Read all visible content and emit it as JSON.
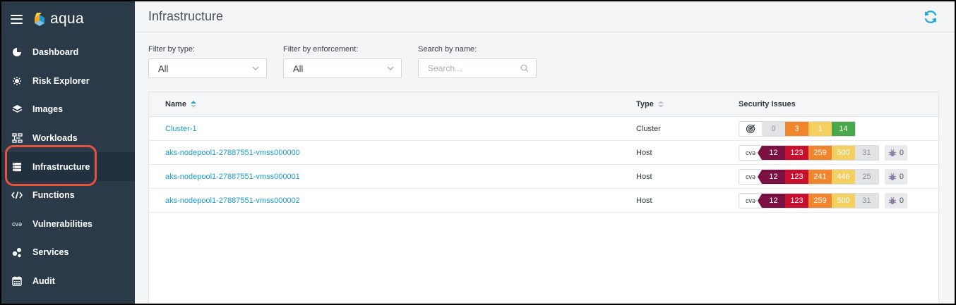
{
  "app": {
    "name": "aqua"
  },
  "sidebar": {
    "items": [
      {
        "label": "Dashboard",
        "icon": "dashboard-icon"
      },
      {
        "label": "Risk Explorer",
        "icon": "risk-explorer-icon"
      },
      {
        "label": "Images",
        "icon": "images-layers-icon"
      },
      {
        "label": "Workloads",
        "icon": "workloads-icon"
      },
      {
        "label": "Infrastructure",
        "icon": "infrastructure-server-icon",
        "active": true
      },
      {
        "label": "Functions",
        "icon": "functions-code-icon"
      },
      {
        "label": "Vulnerabilities",
        "icon": "cve-icon",
        "icon_text": "cvə"
      },
      {
        "label": "Services",
        "icon": "services-icon"
      },
      {
        "label": "Audit",
        "icon": "audit-calendar-icon"
      }
    ]
  },
  "page": {
    "title": "Infrastructure"
  },
  "filters": {
    "type": {
      "label": "Filter by type:",
      "value": "All"
    },
    "enforcement": {
      "label": "Filter by enforcement:",
      "value": "All"
    },
    "search": {
      "label": "Search by name:",
      "placeholder": "Search..."
    }
  },
  "table": {
    "headers": {
      "name": "Name",
      "type": "Type",
      "security": "Security Issues"
    },
    "rows": [
      {
        "name": "Cluster-1",
        "type": "Cluster",
        "lead": "target-icon",
        "neg": "0",
        "med": "3",
        "low": "1",
        "ok": "14"
      },
      {
        "name": "aks-nodepool1-27887551-vmss000000",
        "type": "Host",
        "lead": "cvə",
        "crit": "12",
        "high": "123",
        "med": "259",
        "low": "500",
        "neg": "31",
        "malware": "0"
      },
      {
        "name": "aks-nodepool1-27887551-vmss000001",
        "type": "Host",
        "lead": "cvə",
        "crit": "12",
        "high": "123",
        "med": "241",
        "low": "446",
        "neg": "25",
        "malware": "0"
      },
      {
        "name": "aks-nodepool1-27887551-vmss000002",
        "type": "Host",
        "lead": "cvə",
        "crit": "12",
        "high": "123",
        "med": "259",
        "low": "500",
        "neg": "31",
        "malware": "0"
      }
    ]
  },
  "colors": {
    "sidebar": "#2b3a48",
    "accent": "#2aaacf",
    "critical": "#7b1042",
    "high": "#c8102e",
    "medium": "#f0852d",
    "low": "#f5cf60",
    "negligible": "#e1e3e5",
    "ok": "#4aa84b",
    "highlight": "#e5533e"
  }
}
